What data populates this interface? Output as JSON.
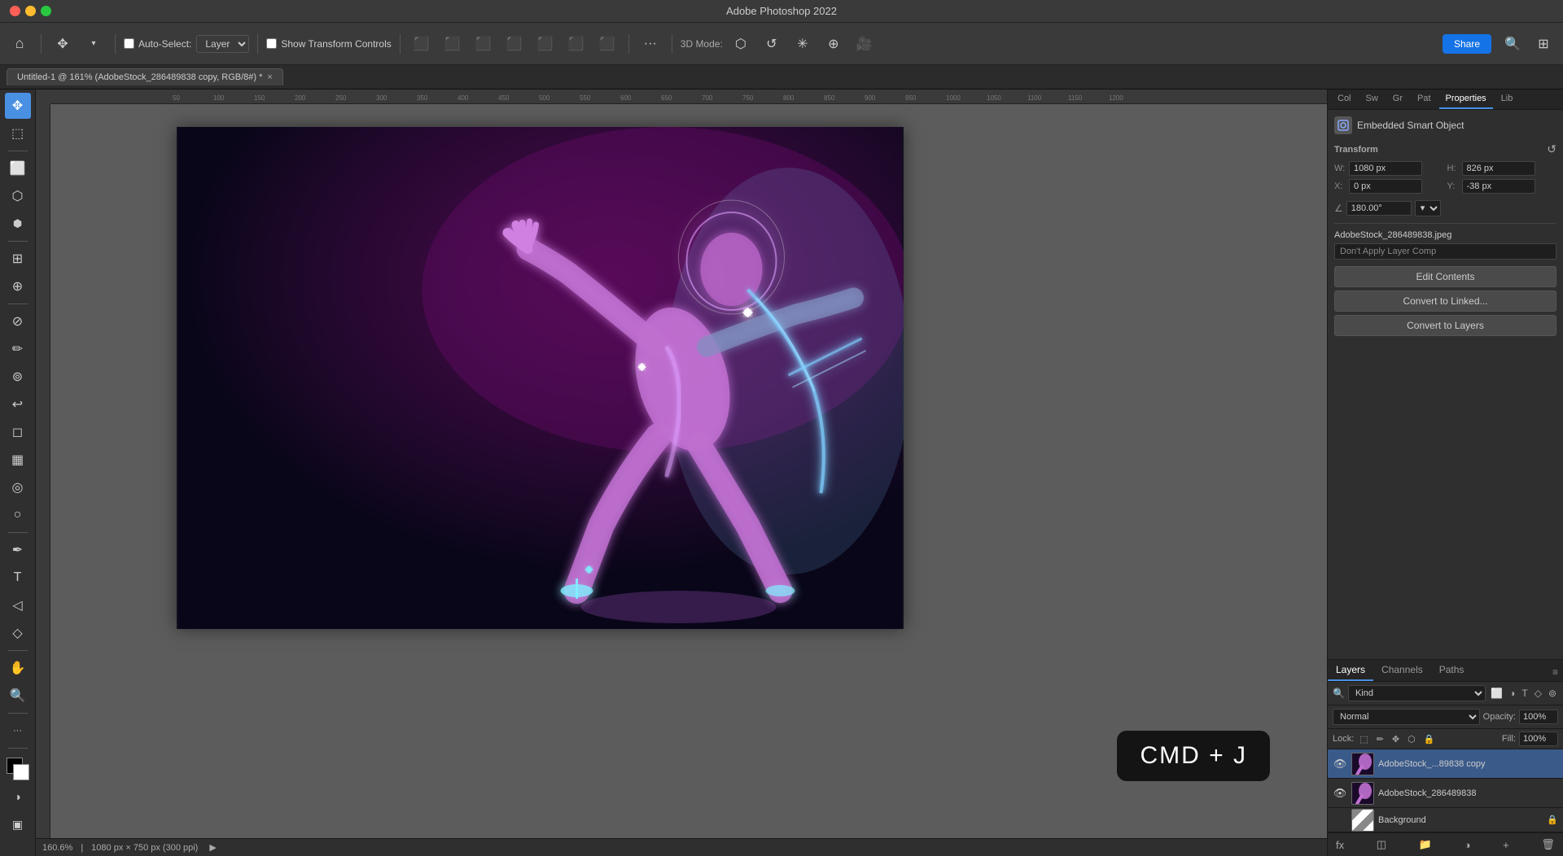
{
  "app": {
    "title": "Adobe Photoshop 2022"
  },
  "titlebar": {
    "title": "Adobe Photoshop 2022"
  },
  "toolbar": {
    "auto_select_label": "Auto-Select:",
    "layer_label": "Layer",
    "show_transform_label": "Show Transform Controls",
    "mode_3d": "3D Mode:",
    "share_label": "Share",
    "more_label": "···"
  },
  "tab": {
    "title": "Untitled-1 @ 161% (AdobeStock_286489838 copy, RGB/8#) *",
    "close": "×"
  },
  "tools": [
    {
      "name": "move",
      "icon": "✥",
      "active": true
    },
    {
      "name": "select-rect",
      "icon": "⬚"
    },
    {
      "name": "lasso",
      "icon": "⬡"
    },
    {
      "name": "quick-select",
      "icon": "⬢"
    },
    {
      "name": "crop",
      "icon": "⊞"
    },
    {
      "name": "eyedropper",
      "icon": "⊕"
    },
    {
      "name": "healing",
      "icon": "⊘"
    },
    {
      "name": "brush",
      "icon": "✏"
    },
    {
      "name": "clone",
      "icon": "⊚"
    },
    {
      "name": "eraser",
      "icon": "◻"
    },
    {
      "name": "gradient",
      "icon": "▦"
    },
    {
      "name": "dodge",
      "icon": "○"
    },
    {
      "name": "pen",
      "icon": "✒"
    },
    {
      "name": "text",
      "icon": "T"
    },
    {
      "name": "path-select",
      "icon": "◁"
    },
    {
      "name": "shape",
      "icon": "◇"
    },
    {
      "name": "hand",
      "icon": "✋"
    },
    {
      "name": "zoom",
      "icon": "⊕"
    },
    {
      "name": "more-tools",
      "icon": "···"
    }
  ],
  "panel_tabs": [
    {
      "id": "col",
      "label": "Col"
    },
    {
      "id": "sw",
      "label": "Sw"
    },
    {
      "id": "gr",
      "label": "Gr"
    },
    {
      "id": "pat",
      "label": "Pat"
    },
    {
      "id": "properties",
      "label": "Properties",
      "active": true
    },
    {
      "id": "lib",
      "label": "Lib"
    }
  ],
  "properties": {
    "object_type": "Embedded Smart Object",
    "transform_title": "Transform",
    "w_label": "W:",
    "w_value": "1080 px",
    "h_label": "H:",
    "h_value": "826 px",
    "x_label": "X:",
    "x_value": "0 px",
    "y_label": "Y:",
    "y_value": "-38 px",
    "angle_value": "180.00°",
    "filename": "AdobeStock_286489838.jpeg",
    "layer_comp_placeholder": "Don't Apply Layer Comp",
    "btn_edit": "Edit Contents",
    "btn_convert_linked": "Convert to Linked...",
    "btn_convert_layers": "Convert to Layers",
    "reset_icon": "↺"
  },
  "layers": {
    "tabs": [
      {
        "id": "layers",
        "label": "Layers",
        "active": true
      },
      {
        "id": "channels",
        "label": "Channels"
      },
      {
        "id": "paths",
        "label": "Paths"
      }
    ],
    "filter_kind": "Kind",
    "blend_mode": "Normal",
    "opacity_label": "Opacity:",
    "opacity_value": "100%",
    "lock_label": "Lock:",
    "fill_label": "Fill:",
    "fill_value": "100%",
    "items": [
      {
        "name": "AdobeStock_...89838 copy",
        "visible": true,
        "selected": true,
        "locked": false
      },
      {
        "name": "AdobeStock_286489838",
        "visible": true,
        "selected": false,
        "locked": false
      }
    ],
    "background": {
      "name": "Background",
      "locked": true
    },
    "footer_icons": [
      "fx",
      "◫",
      "◈",
      "◩",
      "🗑"
    ]
  },
  "status": {
    "zoom": "160.6%",
    "dimensions": "1080 px × 750 px (300 ppi)"
  },
  "kbd_shortcut": "CMD + J"
}
